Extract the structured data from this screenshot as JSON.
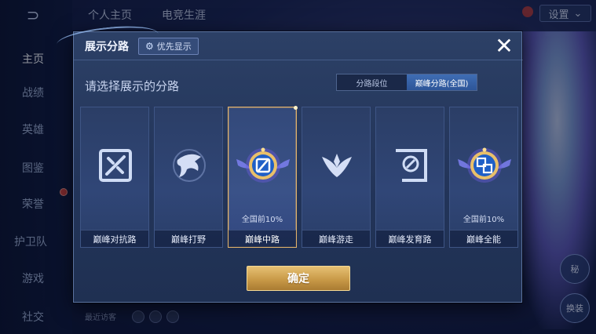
{
  "background": {
    "nav_items": [
      "主页",
      "战绩",
      "英雄",
      "图鉴",
      "荣誉",
      "护卫队",
      "游戏",
      "社交"
    ],
    "top_tabs": [
      "个人主页",
      "电竞生涯"
    ],
    "settings_label": "设置",
    "bottom_hint": "最近访客",
    "right_buttons": [
      "秘",
      "换装"
    ]
  },
  "dialog": {
    "title": "展示分路",
    "priority_label": "优先显示",
    "close_glyph": "✕",
    "subtitle": "请选择展示的分路",
    "segments": [
      {
        "label": "分路段位",
        "active": false
      },
      {
        "label": "巅峰分路(全国)",
        "active": true
      }
    ],
    "cards": [
      {
        "label": "巅峰对抗路",
        "note": "",
        "icon": "clash-lane-icon",
        "selected": false
      },
      {
        "label": "巅峰打野",
        "note": "",
        "icon": "jungle-icon",
        "selected": false
      },
      {
        "label": "巅峰中路",
        "note": "全国前10%",
        "icon": "mid-lane-badge-icon",
        "selected": true
      },
      {
        "label": "巅峰游走",
        "note": "",
        "icon": "roam-icon",
        "selected": false
      },
      {
        "label": "巅峰发育路",
        "note": "",
        "icon": "farm-lane-icon",
        "selected": false
      },
      {
        "label": "巅峰全能",
        "note": "全国前10%",
        "icon": "all-round-badge-icon",
        "selected": false
      }
    ],
    "confirm_label": "确定"
  },
  "colors": {
    "accent_gold": "#e2b36b",
    "segment_active": "#3f6db4",
    "dialog_bg": "#2c4066"
  }
}
